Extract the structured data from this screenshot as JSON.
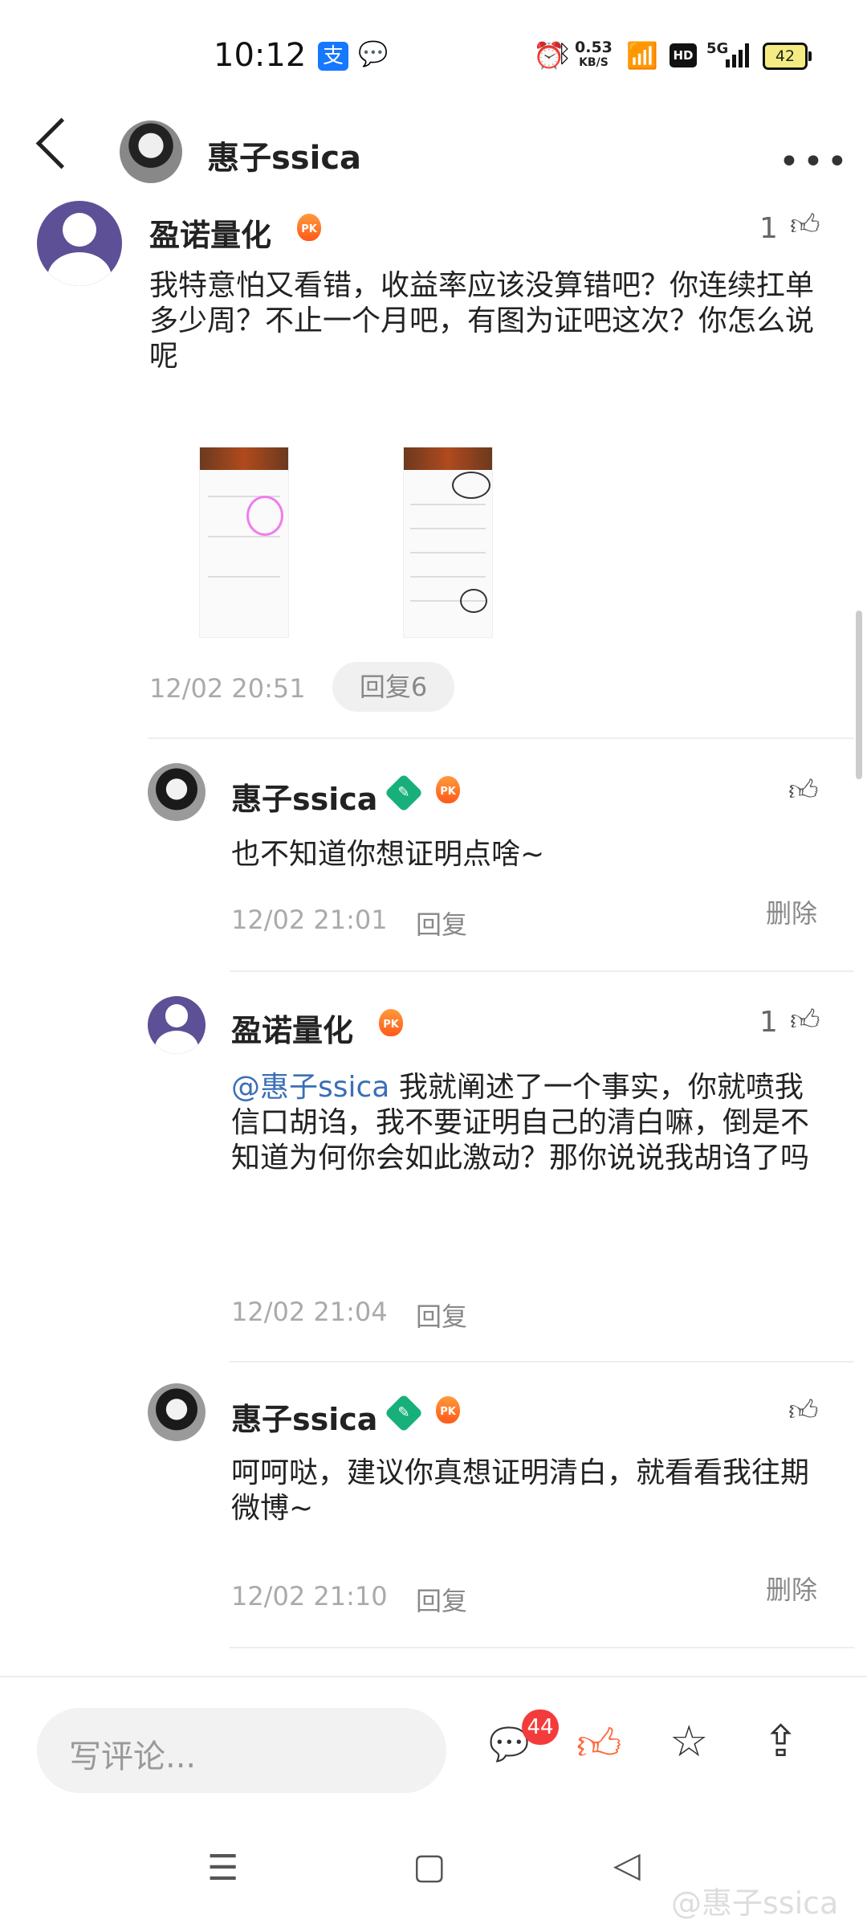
{
  "status_bar": {
    "time": "10:12",
    "pay_icon": "支",
    "net_speed_value": "0.53",
    "net_speed_unit": "KB/S",
    "hd": "HD",
    "signal": "5G",
    "battery": "42"
  },
  "header": {
    "title": "惠子ssica"
  },
  "main_comment": {
    "username": "盈诺量化",
    "like_count": "1",
    "text": "我特意怕又看错，收益率应该没算错吧？你连续扛单多少周？不止一个月吧，有图为证吧这次？你怎么说呢",
    "timestamp": "12/02 20:51",
    "reply_count_label": "回复6"
  },
  "replies": [
    {
      "username": "惠子ssica",
      "text": "也不知道你想证明点啥~",
      "timestamp": "12/02 21:01",
      "reply_label": "回复",
      "delete_label": "删除"
    },
    {
      "username": "盈诺量化",
      "like_count": "1",
      "mention": "@惠子ssica",
      "text": " 我就阐述了一个事实，你就喷我信口胡诌，我不要证明自己的清白嘛，倒是不知道为何你会如此激动？那你说说我胡诌了吗",
      "timestamp": "12/02 21:04",
      "reply_label": "回复"
    },
    {
      "username": "惠子ssica",
      "text": "呵呵哒，建议你真想证明清白，就看看我往期微博~",
      "timestamp": "12/02 21:10",
      "reply_label": "回复",
      "delete_label": "删除"
    }
  ],
  "bottom_bar": {
    "comment_placeholder": "写评论...",
    "comment_badge": "44"
  },
  "watermark": "@惠子ssica",
  "colors": {
    "mention": "#3b6fb6",
    "badge": "#f43b3b",
    "like_active": "#ff6a3d",
    "user_avatar": "#5d5096"
  }
}
